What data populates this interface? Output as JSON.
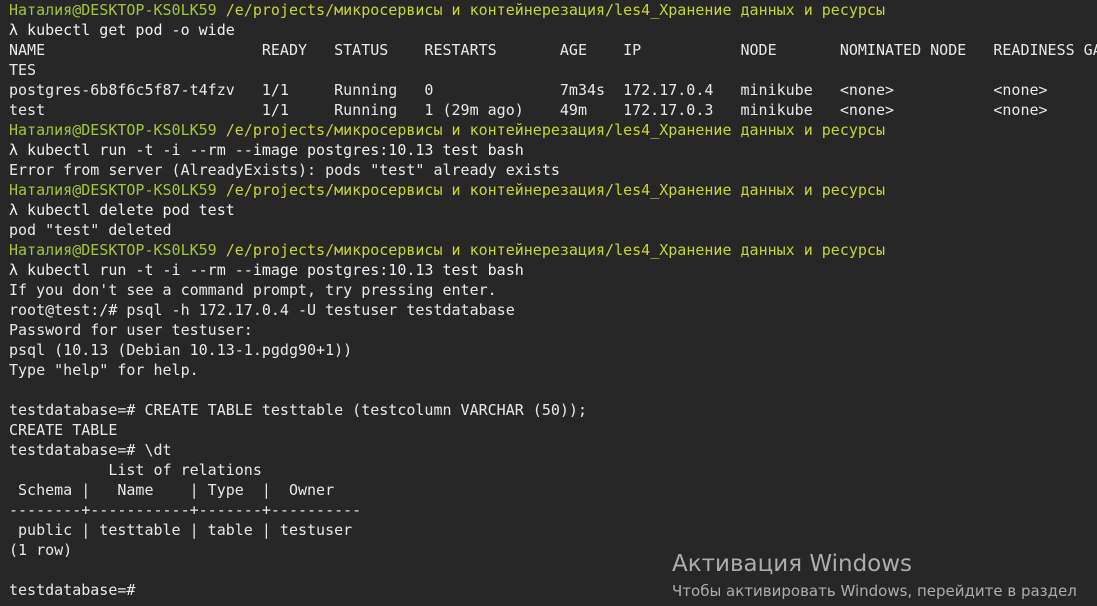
{
  "terminal": {
    "lines": [
      {
        "kind": "prompt",
        "user": "Наталия@DESKTOP-KS0LK59",
        "path": "/e/projects/микросервисы и контейнерезация/les4_Хранение данных и ресурсы"
      },
      {
        "kind": "text",
        "text": "λ kubectl get pod -o wide"
      },
      {
        "kind": "text",
        "text": "NAME                        READY   STATUS    RESTARTS       AGE    IP           NODE       NOMINATED NODE   READINESS GA"
      },
      {
        "kind": "text",
        "text": "TES"
      },
      {
        "kind": "text",
        "text": "postgres-6b8f6c5f87-t4fzv   1/1     Running   0              7m34s  172.17.0.4   minikube   <none>           <none>"
      },
      {
        "kind": "text",
        "text": "test                        1/1     Running   1 (29m ago)    49m    172.17.0.3   minikube   <none>           <none>"
      },
      {
        "kind": "prompt",
        "user": "Наталия@DESKTOP-KS0LK59",
        "path": "/e/projects/микросервисы и контейнерезация/les4_Хранение данных и ресурсы"
      },
      {
        "kind": "text",
        "text": "λ kubectl run -t -i --rm --image postgres:10.13 test bash"
      },
      {
        "kind": "text",
        "text": "Error from server (AlreadyExists): pods \"test\" already exists"
      },
      {
        "kind": "prompt",
        "user": "Наталия@DESKTOP-KS0LK59",
        "path": "/e/projects/микросервисы и контейнерезация/les4_Хранение данных и ресурсы"
      },
      {
        "kind": "text",
        "text": "λ kubectl delete pod test"
      },
      {
        "kind": "text",
        "text": "pod \"test\" deleted"
      },
      {
        "kind": "prompt",
        "user": "Наталия@DESKTOP-KS0LK59",
        "path": "/e/projects/микросервисы и контейнерезация/les4_Хранение данных и ресурсы"
      },
      {
        "kind": "text",
        "text": "λ kubectl run -t -i --rm --image postgres:10.13 test bash"
      },
      {
        "kind": "text",
        "text": "If you don't see a command prompt, try pressing enter."
      },
      {
        "kind": "text",
        "text": "root@test:/# psql -h 172.17.0.4 -U testuser testdatabase"
      },
      {
        "kind": "text",
        "text": "Password for user testuser:"
      },
      {
        "kind": "text",
        "text": "psql (10.13 (Debian 10.13-1.pgdg90+1))"
      },
      {
        "kind": "text",
        "text": "Type \"help\" for help."
      },
      {
        "kind": "text",
        "text": ""
      },
      {
        "kind": "text",
        "text": "testdatabase=# CREATE TABLE testtable (testcolumn VARCHAR (50));"
      },
      {
        "kind": "text",
        "text": "CREATE TABLE"
      },
      {
        "kind": "text",
        "text": "testdatabase=# \\dt"
      },
      {
        "kind": "text",
        "text": "           List of relations"
      },
      {
        "kind": "text",
        "text": " Schema |   Name    | Type  |  Owner"
      },
      {
        "kind": "text",
        "text": "--------+-----------+-------+----------"
      },
      {
        "kind": "text",
        "text": " public | testtable | table | testuser"
      },
      {
        "kind": "text",
        "text": "(1 row)"
      },
      {
        "kind": "text",
        "text": ""
      },
      {
        "kind": "text",
        "text": "testdatabase=#"
      }
    ]
  },
  "watermark": {
    "title": "Активация Windows",
    "subtitle": "Чтобы активировать Windows, перейдите в раздел"
  },
  "colors": {
    "background": "#272727",
    "prompt_user": "#a6c43a",
    "prompt_path": "#c7d630",
    "text": "#e8e8e8"
  }
}
